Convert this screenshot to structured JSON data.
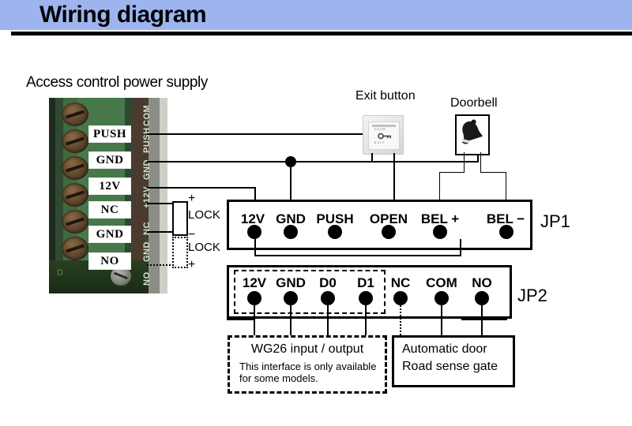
{
  "header": {
    "title": "Wiring diagram",
    "bar_color": "#9db4ef"
  },
  "psu": {
    "caption": "Access control power supply",
    "terminal_labels": [
      "PUSH",
      "GND",
      "12V",
      "NC",
      "GND",
      "NO"
    ],
    "silkscreen_labels": [
      "COM",
      "PUSH",
      "GND",
      "+12V",
      "NC",
      "GND",
      "NO"
    ],
    "board_marking": "D"
  },
  "locks": {
    "lock1_name": "LOCK",
    "lock1_plus": "+",
    "lock1_minus": "−",
    "lock2_name": "LOCK",
    "lock2_plus": "+"
  },
  "devices": {
    "exit_button": {
      "label": "Exit button",
      "face_top_text": "DOOR",
      "face_bottom_text": "EXIT",
      "icon": "key-icon"
    },
    "doorbell": {
      "label": "Doorbell",
      "icon": "bell-icon"
    }
  },
  "jp1": {
    "name": "JP1",
    "pins": [
      {
        "label": "12V"
      },
      {
        "label": "GND"
      },
      {
        "label": "PUSH"
      },
      {
        "label": "OPEN"
      },
      {
        "label": "BEL +"
      },
      {
        "label": "BEL −"
      }
    ]
  },
  "jp2": {
    "name": "JP2",
    "pins": [
      {
        "label": "12V"
      },
      {
        "label": "GND"
      },
      {
        "label": "D0"
      },
      {
        "label": "D1"
      },
      {
        "label": "NC"
      },
      {
        "label": "COM"
      },
      {
        "label": "NO"
      }
    ]
  },
  "annotations": {
    "wg26": {
      "title": "WG26 input / output",
      "note": "This interface is only available for some models."
    },
    "automatic_door": {
      "line1": "Automatic door",
      "line2": "Road sense gate"
    }
  }
}
